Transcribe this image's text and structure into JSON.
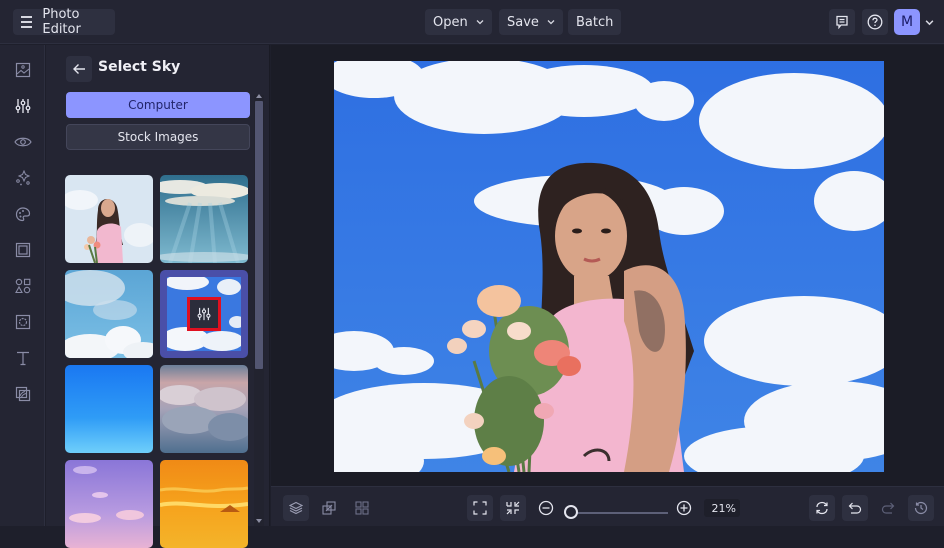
{
  "app": {
    "title": "Photo Editor",
    "menu_icon": "hamburger-menu-icon"
  },
  "toolbar": {
    "open_label": "Open",
    "save_label": "Save",
    "batch_label": "Batch",
    "feedback_icon": "feedback-icon",
    "help_icon": "help-icon",
    "avatar_initial": "M"
  },
  "rail": {
    "items": [
      {
        "name": "image",
        "icon": "image-icon",
        "active": false
      },
      {
        "name": "adjustments",
        "icon": "sliders-icon",
        "active": true
      },
      {
        "name": "view",
        "icon": "eye-icon",
        "active": false
      },
      {
        "name": "effects",
        "icon": "sparkle-icon",
        "active": false
      },
      {
        "name": "artsy",
        "icon": "palette-icon",
        "active": false
      },
      {
        "name": "frames",
        "icon": "frame-icon",
        "active": false
      },
      {
        "name": "graphics",
        "icon": "shapes-icon",
        "active": false
      },
      {
        "name": "overlays",
        "icon": "overlay-icon",
        "active": false
      },
      {
        "name": "text",
        "icon": "text-icon",
        "active": false
      },
      {
        "name": "textures",
        "icon": "texture-icon",
        "active": false
      }
    ]
  },
  "panel": {
    "title": "Select Sky",
    "back_icon": "arrow-left-icon",
    "source_buttons": {
      "computer": "Computer",
      "stock": "Stock Images"
    },
    "thumbnails": [
      {
        "name": "sky-thumb-original",
        "kind": "original-photo"
      },
      {
        "name": "sky-thumb-sunrays",
        "kind": "sunrays"
      },
      {
        "name": "sky-thumb-cumulus",
        "kind": "cumulus"
      },
      {
        "name": "sky-thumb-blue-clouds",
        "kind": "blue-clouds",
        "selected": true
      },
      {
        "name": "sky-thumb-clear-blue",
        "kind": "clear-blue"
      },
      {
        "name": "sky-thumb-above-clouds",
        "kind": "above-clouds"
      },
      {
        "name": "sky-thumb-purple",
        "kind": "purple"
      },
      {
        "name": "sky-thumb-sunset",
        "kind": "sunset"
      }
    ]
  },
  "bottombar": {
    "zoom_percent": "21%",
    "zoom_level": 0.21
  },
  "colors": {
    "accent": "#8c95ff",
    "highlight": "#e01020"
  }
}
